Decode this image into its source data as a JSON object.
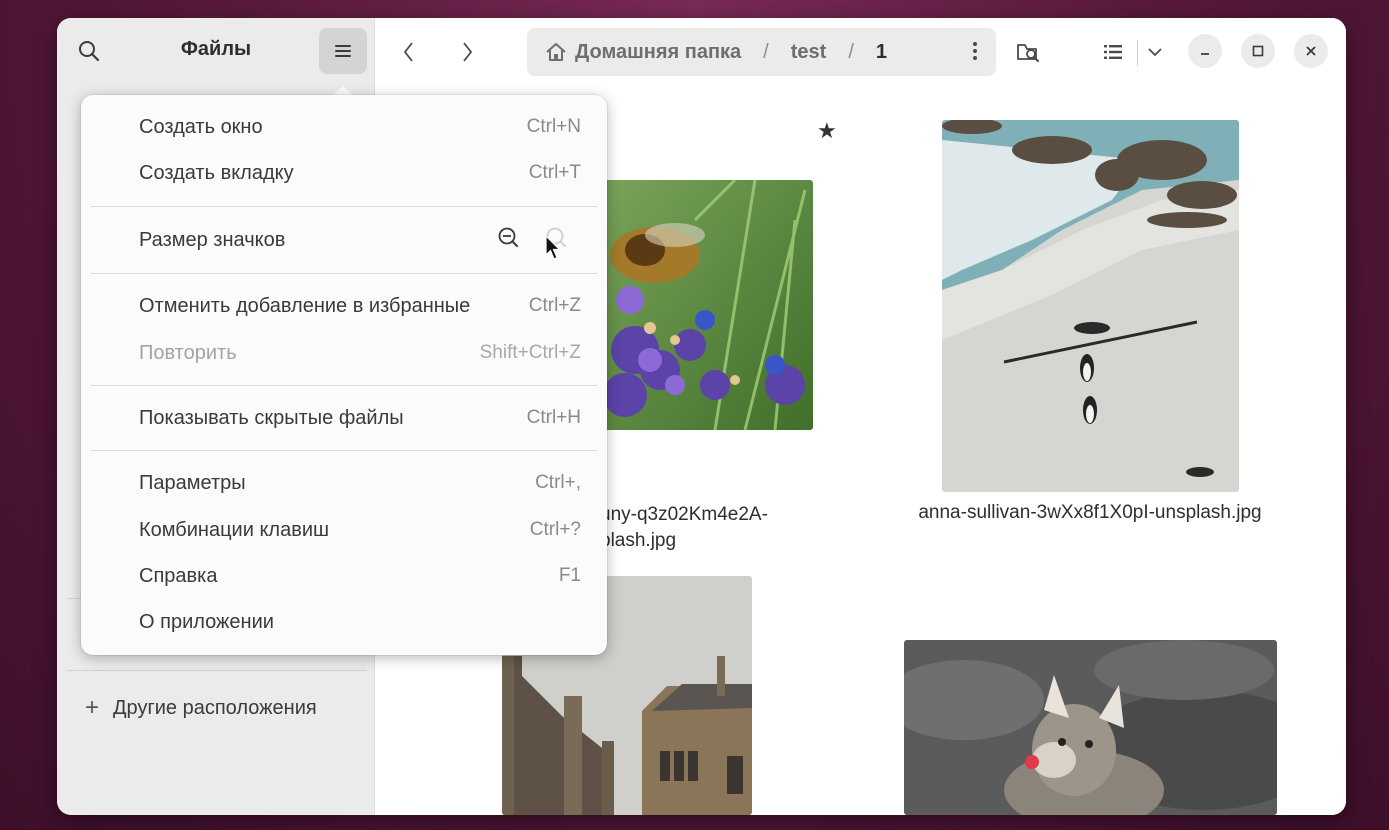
{
  "sidebar": {
    "title": "Файлы",
    "other_locations": "Другие расположения"
  },
  "path": {
    "segments": [
      "Домашняя папка",
      "test",
      "1"
    ],
    "separator": "/"
  },
  "files": [
    {
      "name_line1": "uny-q3z02Km4e2A-",
      "name_line2": "plash.jpg",
      "starred": true
    },
    {
      "name": "anna-sullivan-3wXx8f1X0pI-unsplash.jpg",
      "starred": false
    }
  ],
  "menu": {
    "new_window": {
      "label": "Создать окно",
      "accel": "Ctrl+N"
    },
    "new_tab": {
      "label": "Создать вкладку",
      "accel": "Ctrl+T"
    },
    "icon_size": {
      "label": "Размер значков"
    },
    "undo": {
      "label": "Отменить добавление в избранные",
      "accel": "Ctrl+Z"
    },
    "redo": {
      "label": "Повторить",
      "accel": "Shift+Ctrl+Z",
      "disabled": true
    },
    "show_hidden": {
      "label": "Показывать скрытые файлы",
      "accel": "Ctrl+H"
    },
    "preferences": {
      "label": "Параметры",
      "accel": "Ctrl+,"
    },
    "shortcuts": {
      "label": "Комбинации клавиш",
      "accel": "Ctrl+?"
    },
    "help": {
      "label": "Справка",
      "accel": "F1"
    },
    "about": {
      "label": "О приложении"
    }
  },
  "icons": {
    "search": "search-icon",
    "menu": "hamburger-menu-icon",
    "back": "chevron-left-icon",
    "forward": "chevron-right-icon",
    "home": "home-icon",
    "more": "vertical-dots-icon",
    "search_folder": "folder-search-icon",
    "list_view": "list-view-icon",
    "view_options": "chevron-down-icon",
    "minimize": "minimize-icon",
    "maximize": "maximize-icon",
    "close": "close-icon",
    "zoom_out": "zoom-out-icon",
    "zoom_in": "zoom-in-icon",
    "star": "star-icon",
    "plus": "plus-icon"
  },
  "colors": {
    "desktop_bg": "#5a1a3d",
    "sidebar_bg": "#ebebeb",
    "window_bg": "#ffffff",
    "popover_bg": "#fbfbfb"
  }
}
